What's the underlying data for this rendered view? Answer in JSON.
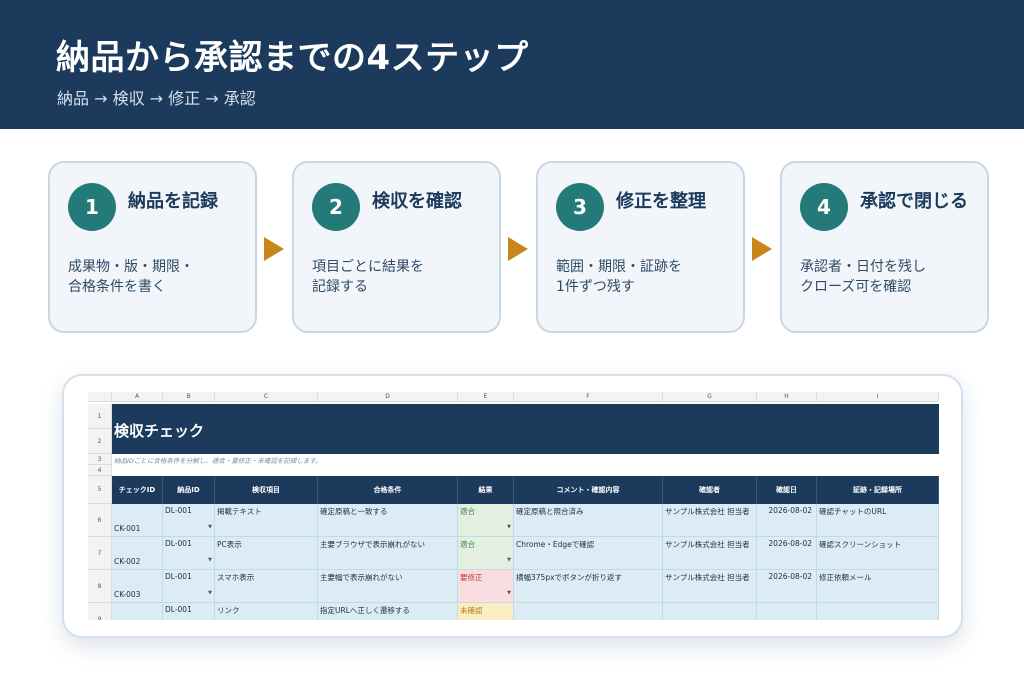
{
  "header": {
    "title": "納品から承認までの4ステップ",
    "subtitle": "納品 → 検収 → 修正 → 承認"
  },
  "steps": [
    {
      "num": "1",
      "title": "納品を記録",
      "desc": "成果物・版・期限・\n合格条件を書く"
    },
    {
      "num": "2",
      "title": "検収を確認",
      "desc": "項目ごとに結果を\n記録する"
    },
    {
      "num": "3",
      "title": "修正を整理",
      "desc": "範囲・期限・証跡を\n1件ずつ残す"
    },
    {
      "num": "4",
      "title": "承認で閉じる",
      "desc": "承認者・日付を残し\nクローズ可を確認"
    }
  ],
  "sheet": {
    "col_letters": [
      "A",
      "B",
      "C",
      "D",
      "E",
      "F",
      "G",
      "H",
      "I"
    ],
    "row_numbers": [
      "1",
      "2",
      "3",
      "4",
      "5",
      "6",
      "7",
      "8",
      "9"
    ],
    "title": "検収チェック",
    "note": "納品IDごとに合格条件を分解し、適合・要修正・未確認を記録します。",
    "headers": [
      "チェックID",
      "納品ID",
      "検収項目",
      "合格条件",
      "結果",
      "コメント・確認内容",
      "確認者",
      "確認日",
      "証跡・記録場所"
    ],
    "rows": [
      [
        "CK-001",
        "DL-001",
        "掲載テキスト",
        "確定原稿と一致する",
        "適合",
        "確定原稿と照合済み",
        "サンプル株式会社 担当者",
        "2026-08-02",
        "確認チャットのURL"
      ],
      [
        "CK-002",
        "DL-001",
        "PC表示",
        "主要ブラウザで表示崩れがない",
        "適合",
        "Chrome・Edgeで確認",
        "サンプル株式会社 担当者",
        "2026-08-02",
        "確認スクリーンショット"
      ],
      [
        "CK-003",
        "DL-001",
        "スマホ表示",
        "主要幅で表示崩れがない",
        "要修正",
        "横幅375pxでボタンが折り返す",
        "サンプル株式会社 担当者",
        "2026-08-02",
        "修正依頼メール"
      ],
      [
        "",
        "DL-001",
        "リンク",
        "指定URLへ正しく遷移する",
        "未確認",
        "",
        "",
        "",
        ""
      ]
    ]
  },
  "colors": {
    "navy": "#1c3a5c",
    "teal": "#247a78",
    "arrow": "#c8861a",
    "result_ok": "#3c8a4a",
    "result_fix": "#c0392b",
    "result_pending": "#b37a12"
  }
}
